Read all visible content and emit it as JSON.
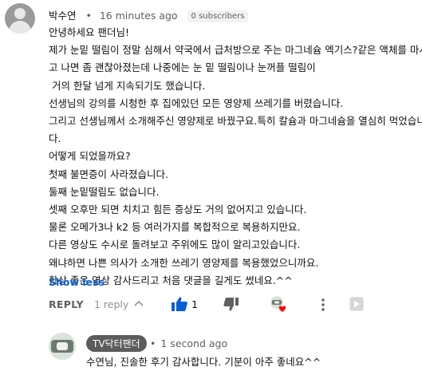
{
  "comment": {
    "author": "박수연",
    "time": "16 minutes ago",
    "subscriber_badge": "0 subscribers",
    "lines": [
      "안녕하세요 팬더님!",
      "제가 눈밑 떨림이 정말 심해서 약국에서 급처방으로 주는 마그네슘 엑기스?같은 액체를 마시",
      "고 나면 좀 괜찮아졌는데 나중에는 눈 밑 떨림이나 눈꺼플 떨림이",
      " 거의 한달 넘게 지속되기도 했습니다.",
      "선생님의 강의를 시청한 후 집에있던 모든 영양제 쓰레기를 버렸습니다.",
      "그리고 선생님께서 소개해주신 영양제로 바꿨구요.특히 칼슘과 마그네슘을 열심히 먹었습니",
      "다.",
      "어떻게 되었을까요?",
      "첫째 불면증이 사라졌습니다.",
      "둘째 눈밑떨림도 없습니다.",
      "셋째 오후만 되면 치치고 힘든 증상도 거의 없어지고 있습니다.",
      "물론 오메가3나 k2 등 여러가지를 복합적으로 복용하지만요.",
      "다른 영상도 수시로 돌려보고 주위에도 많이 알리고있습니다.",
      "왜냐하면 나쁜 의사가 소개한 쓰레기 영양제를 복용했었으니까요.",
      "항상 좋은 영상 감사드리고 처음 댓글을 길게도 썼네요.^^"
    ],
    "show_less": "Show less"
  },
  "actions": {
    "reply_label": "REPLY",
    "reply_count": "1 reply",
    "like_count": "1"
  },
  "reply": {
    "channel": "TV닥터팬더",
    "time": "1 second ago",
    "text": "수연님, 진솔한 후기 감사합니다. 기분이 아주 좋네요^^"
  },
  "colors": {
    "link": "#065fd4",
    "like_active": "#065fd4",
    "heart": "#ff0000",
    "secondary_text": "#606060"
  }
}
